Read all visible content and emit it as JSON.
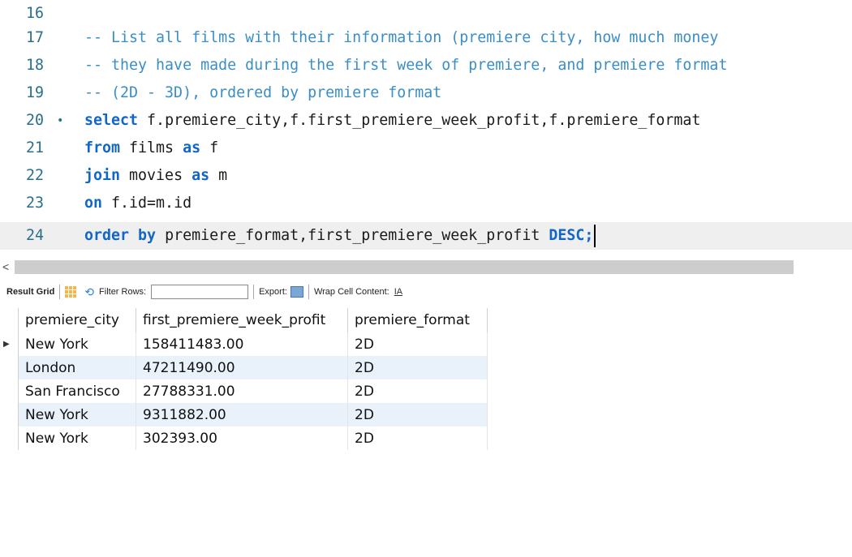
{
  "editor": {
    "lines": [
      {
        "num": "16",
        "marker": "",
        "parts": []
      },
      {
        "num": "17",
        "marker": "",
        "parts": [
          {
            "t": "cmt",
            "s": "-- List all films with their information (premiere city, how much money"
          }
        ]
      },
      {
        "num": "18",
        "marker": "",
        "parts": [
          {
            "t": "cmt",
            "s": "-- they have made during the first week of premiere, and premiere format"
          }
        ]
      },
      {
        "num": "19",
        "marker": "",
        "parts": [
          {
            "t": "cmt",
            "s": "-- (2D - 3D), ordered by premiere format"
          }
        ]
      },
      {
        "num": "20",
        "marker": "•",
        "parts": [
          {
            "t": "kw",
            "s": "select"
          },
          {
            "t": "txt",
            "s": " f.premiere_city,f.first_premiere_week_profit,f.premiere_format"
          }
        ]
      },
      {
        "num": "21",
        "marker": "",
        "parts": [
          {
            "t": "kw",
            "s": "from"
          },
          {
            "t": "txt",
            "s": " films "
          },
          {
            "t": "kw",
            "s": "as"
          },
          {
            "t": "txt",
            "s": " f"
          }
        ]
      },
      {
        "num": "22",
        "marker": "",
        "parts": [
          {
            "t": "kw",
            "s": "join"
          },
          {
            "t": "txt",
            "s": " movies "
          },
          {
            "t": "kw",
            "s": "as"
          },
          {
            "t": "txt",
            "s": " m"
          }
        ]
      },
      {
        "num": "23",
        "marker": "",
        "parts": [
          {
            "t": "kw",
            "s": "on"
          },
          {
            "t": "txt",
            "s": " f.id=m.id"
          }
        ]
      },
      {
        "num": "24",
        "marker": "",
        "current": true,
        "parts": [
          {
            "t": "kw",
            "s": "order by"
          },
          {
            "t": "txt",
            "s": " premiere_format,first_premiere_week_profit "
          },
          {
            "t": "kw",
            "s": "DESC;"
          }
        ]
      }
    ]
  },
  "scrollbar": {
    "left_arrow": "<"
  },
  "toolbar": {
    "result_grid_label": "Result Grid",
    "filter_label": "Filter Rows:",
    "filter_value": "",
    "export_label": "Export:",
    "wrap_label": "Wrap Cell Content:",
    "wrap_icon": "IA"
  },
  "grid": {
    "columns": [
      "premiere_city",
      "first_premiere_week_profit",
      "premiere_format"
    ],
    "rows": [
      [
        "New York",
        "158411483.00",
        "2D"
      ],
      [
        "London",
        "47211490.00",
        "2D"
      ],
      [
        "San Francisco",
        "27788331.00",
        "2D"
      ],
      [
        "New York",
        "9311882.00",
        "2D"
      ],
      [
        "New York",
        "302393.00",
        "2D"
      ]
    ],
    "selected_row_marker": "▶"
  },
  "colors": {
    "keyword": "#1166c9",
    "comment": "#3a8ec6",
    "line_number": "#2a6f8a",
    "alt_row": "#e9f1fb"
  }
}
